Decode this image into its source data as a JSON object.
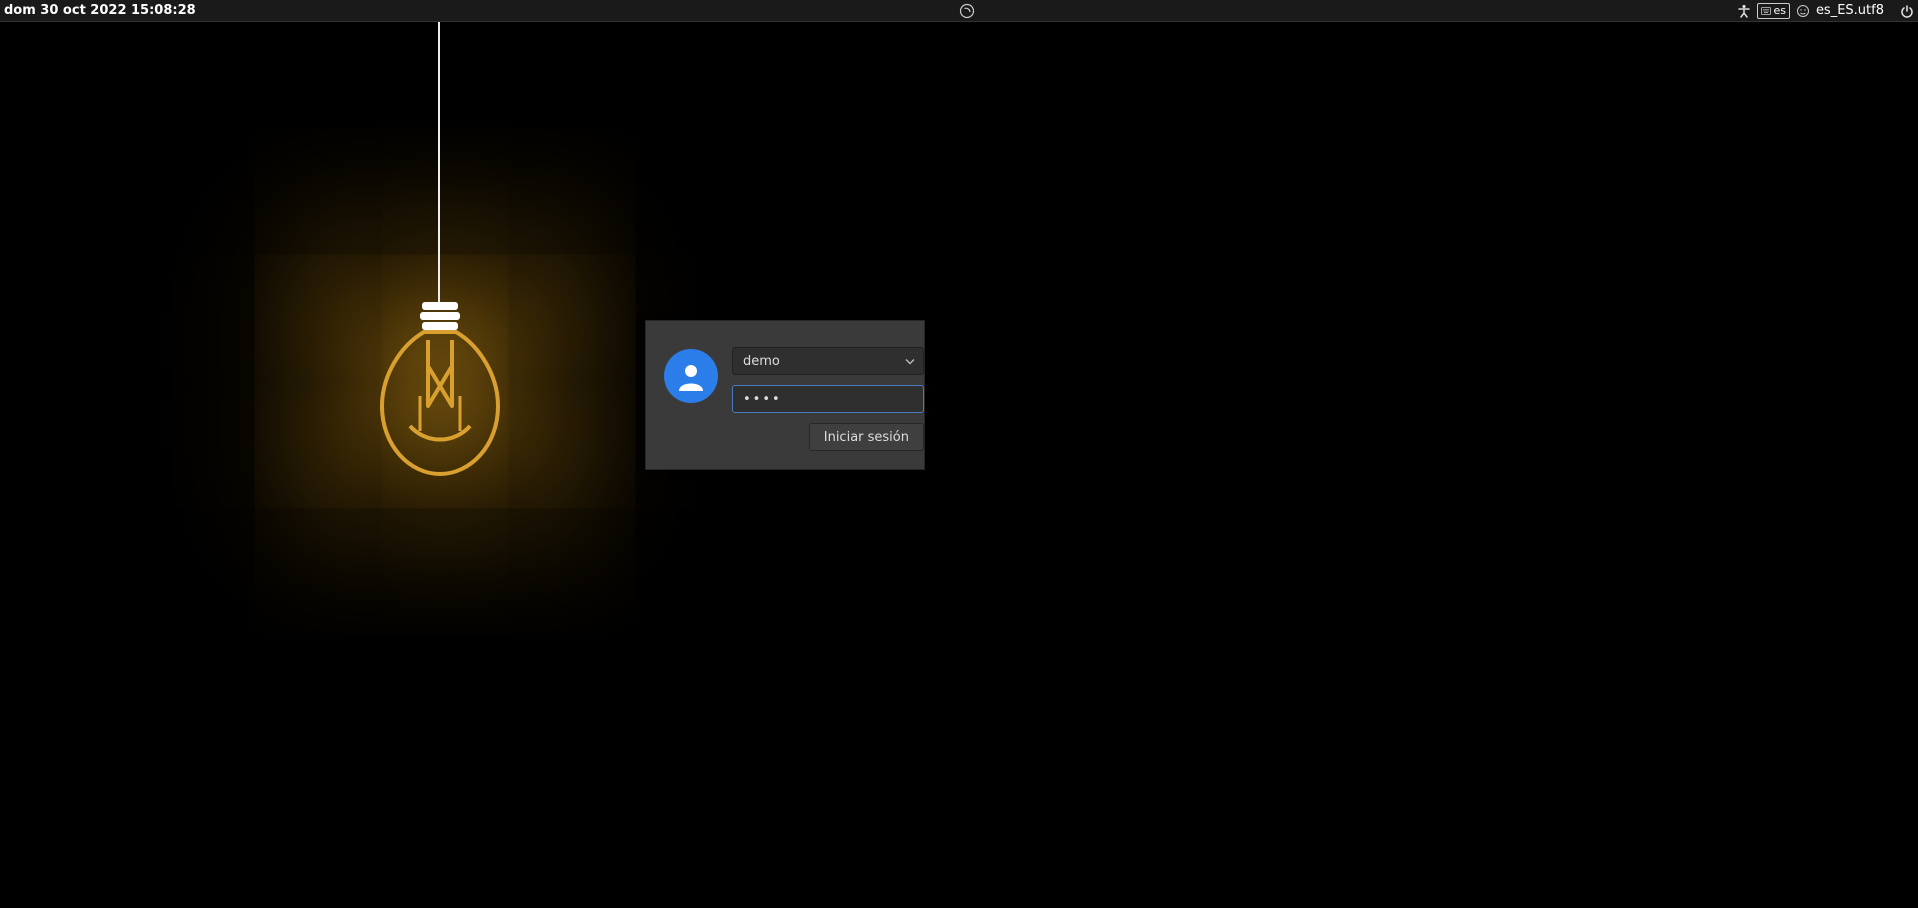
{
  "topbar": {
    "datetime": "dom 30 oct 2022 15:08:28",
    "keyboard_layout": "es",
    "locale": "es_ES.utf8"
  },
  "login": {
    "selected_user": "demo",
    "password_value": "••••",
    "login_button": "Iniciar sesión"
  }
}
